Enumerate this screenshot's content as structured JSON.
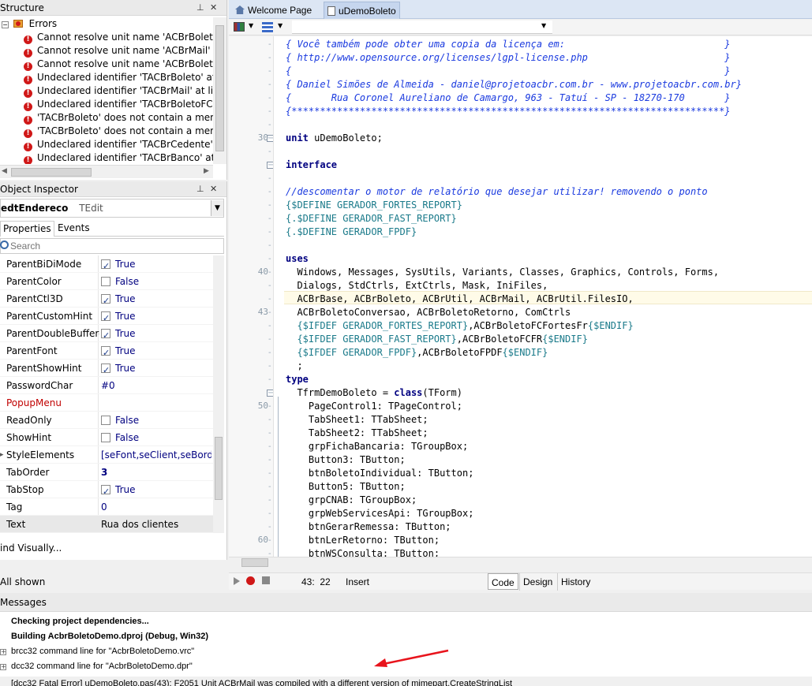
{
  "structure": {
    "title": "Structure",
    "root_label": "Errors",
    "errors": [
      "Cannot resolve unit name 'ACBrBoleto",
      "Cannot resolve unit name 'ACBrMail' a",
      "Cannot resolve unit name 'ACBrBoleto",
      "Undeclared identifier 'TACBrBoleto' at",
      "Undeclared identifier 'TACBrMail' at lin",
      "Undeclared identifier 'TACBrBoletoFCF",
      "'TACBrBoleto' does not contain a men",
      "'TACBrBoleto' does not contain a men",
      "Undeclared identifier 'TACBrCedente'",
      "Undeclared identifier 'TACBrBanco' at"
    ]
  },
  "inspector": {
    "title": "Object Inspector",
    "component_name": "edtEndereco",
    "component_type": "TEdit",
    "tabs": [
      "Properties",
      "Events"
    ],
    "search_placeholder": "Search",
    "properties": [
      {
        "name": "ParentBiDiMode",
        "value": "True",
        "checkbox": true,
        "checked": true
      },
      {
        "name": "ParentColor",
        "value": "False",
        "checkbox": true,
        "checked": false
      },
      {
        "name": "ParentCtl3D",
        "value": "True",
        "checkbox": true,
        "checked": true
      },
      {
        "name": "ParentCustomHint",
        "value": "True",
        "checkbox": true,
        "checked": true
      },
      {
        "name": "ParentDoubleBuffere",
        "value": "True",
        "checkbox": true,
        "checked": true
      },
      {
        "name": "ParentFont",
        "value": "True",
        "checkbox": true,
        "checked": true
      },
      {
        "name": "ParentShowHint",
        "value": "True",
        "checkbox": true,
        "checked": true
      },
      {
        "name": "PasswordChar",
        "value": "#0",
        "checkbox": false
      },
      {
        "name": "PopupMenu",
        "value": "",
        "checkbox": false,
        "red": true
      },
      {
        "name": "ReadOnly",
        "value": "False",
        "checkbox": true,
        "checked": false
      },
      {
        "name": "ShowHint",
        "value": "False",
        "checkbox": true,
        "checked": false
      },
      {
        "name": "StyleElements",
        "value": "[seFont,seClient,seBorde",
        "checkbox": false,
        "expandable": true
      },
      {
        "name": "TabOrder",
        "value": "3",
        "checkbox": false,
        "bold": true
      },
      {
        "name": "TabStop",
        "value": "True",
        "checkbox": true,
        "checked": true
      },
      {
        "name": "Tag",
        "value": "0",
        "checkbox": false
      },
      {
        "name": "Text",
        "value": "Rua dos clientes",
        "checkbox": false,
        "selected": true
      }
    ],
    "find_visually": "ind Visually...",
    "all_shown": "All shown"
  },
  "editor": {
    "tabs": [
      "Welcome Page",
      "uDemoBoleto"
    ],
    "active_tab": "uDemoBoleto",
    "cursor_pos": "43:  22",
    "insert_mode": "Insert",
    "view_tabs": [
      "Code",
      "Design",
      "History"
    ],
    "line_numbers": [
      {
        "label": "30",
        "line": 8
      },
      {
        "label": "40",
        "line": 18
      },
      {
        "label": "43",
        "line": 21
      },
      {
        "label": "50",
        "line": 28
      },
      {
        "label": "60",
        "line": 38
      }
    ],
    "code": [
      {
        "t": "cm",
        "text": "{ Você também pode obter uma copia da licença em:                            }"
      },
      {
        "t": "cm",
        "text": "{ http://www.opensource.org/licenses/lgpl-license.php                        }"
      },
      {
        "t": "cm",
        "text": "{                                                                            }"
      },
      {
        "t": "cm",
        "text": "{ Daniel Simões de Almeida - daniel@projetoacbr.com.br - www.projetoacbr.com.br}"
      },
      {
        "t": "cm",
        "text": "{       Rua Coronel Aureliano de Camargo, 963 - Tatuí - SP - 18270-170       }"
      },
      {
        "t": "cm",
        "text": "{****************************************************************************}"
      },
      {
        "t": "plain",
        "text": ""
      },
      {
        "t": "mixed",
        "parts": [
          [
            "kw",
            "unit"
          ],
          [
            "plain",
            " uDemoBoleto;"
          ]
        ]
      },
      {
        "t": "plain",
        "text": ""
      },
      {
        "t": "kw",
        "text": "interface"
      },
      {
        "t": "plain",
        "text": ""
      },
      {
        "t": "cm",
        "text": "//descomentar o motor de relatório que desejar utilizar! removendo o ponto"
      },
      {
        "t": "dir",
        "text": "{$DEFINE GERADOR_FORTES_REPORT}"
      },
      {
        "t": "dir",
        "text": "{.$DEFINE GERADOR_FAST_REPORT}"
      },
      {
        "t": "dir",
        "text": "{.$DEFINE GERADOR_FPDF}"
      },
      {
        "t": "plain",
        "text": ""
      },
      {
        "t": "kw",
        "text": "uses"
      },
      {
        "t": "plain",
        "text": "  Windows, Messages, SysUtils, Variants, Classes, Graphics, Controls, Forms,"
      },
      {
        "t": "plain",
        "text": "  Dialogs, StdCtrls, ExtCtrls, Mask, IniFiles,"
      },
      {
        "t": "plain",
        "text": "  ACBrBase, ACBrBoleto, ACBrUtil, ACBrMail, ACBrUtil.FilesIO,"
      },
      {
        "t": "plain",
        "text": "  ACBrBoletoConversao, ACBrBoletoRetorno, ComCtrls"
      },
      {
        "t": "mixed",
        "parts": [
          [
            "dir",
            "  {$IFDEF GERADOR_FORTES_REPORT}"
          ],
          [
            "plain",
            ",ACBrBoletoFCFortesFr"
          ],
          [
            "dir",
            "{$ENDIF}"
          ]
        ]
      },
      {
        "t": "mixed",
        "parts": [
          [
            "dir",
            "  {$IFDEF GERADOR_FAST_REPORT}"
          ],
          [
            "plain",
            ",ACBrBoletoFCFR"
          ],
          [
            "dir",
            "{$ENDIF}"
          ]
        ]
      },
      {
        "t": "mixed",
        "parts": [
          [
            "dir",
            "  {$IFDEF GERADOR_FPDF}"
          ],
          [
            "plain",
            ",ACBrBoletoFPDF"
          ],
          [
            "dir",
            "{$ENDIF}"
          ]
        ]
      },
      {
        "t": "plain",
        "text": "  ;"
      },
      {
        "t": "kw",
        "text": "type"
      },
      {
        "t": "mixed",
        "parts": [
          [
            "plain",
            "  TfrmDemoBoleto = "
          ],
          [
            "kw",
            "class"
          ],
          [
            "plain",
            "(TForm)"
          ]
        ]
      },
      {
        "t": "plain",
        "text": "    PageControl1: TPageControl;"
      },
      {
        "t": "plain",
        "text": "    TabSheet1: TTabSheet;"
      },
      {
        "t": "plain",
        "text": "    TabSheet2: TTabSheet;"
      },
      {
        "t": "plain",
        "text": "    grpFichaBancaria: TGroupBox;"
      },
      {
        "t": "plain",
        "text": "    Button3: TButton;"
      },
      {
        "t": "plain",
        "text": "    btnBoletoIndividual: TButton;"
      },
      {
        "t": "plain",
        "text": "    Button5: TButton;"
      },
      {
        "t": "plain",
        "text": "    grpCNAB: TGroupBox;"
      },
      {
        "t": "plain",
        "text": "    grpWebServicesApi: TGroupBox;"
      },
      {
        "t": "plain",
        "text": "    btnGerarRemessa: TButton;"
      },
      {
        "t": "plain",
        "text": "    btnLerRetorno: TButton;"
      },
      {
        "t": "plain",
        "text": "    btnWSConsulta: TButton;"
      }
    ]
  },
  "messages": {
    "title": "Messages",
    "items": [
      {
        "text": "Checking project dependencies...",
        "bold": true,
        "expander": false
      },
      {
        "text": "Building AcbrBoletoDemo.dproj (Debug, Win32)",
        "bold": true,
        "expander": false
      },
      {
        "text": "brcc32 command line for \"AcbrBoletoDemo.vrc\"",
        "bold": false,
        "expander": true
      },
      {
        "text": "dcc32 command line for \"AcbrBoletoDemo.dpr\"",
        "bold": false,
        "expander": true
      },
      {
        "text": "[dcc32 Fatal Error] uDemoBoleto.pas(43): F2051 Unit ACBrMail was compiled with a different version of mimepart.CreateStringList",
        "bold": false,
        "expander": false,
        "error": true
      }
    ]
  },
  "colors": {
    "error_icon": "#d01818",
    "annotation_arrow": "#e8141c",
    "current_line": "#fffbe8",
    "comment": "#1a3adf"
  }
}
